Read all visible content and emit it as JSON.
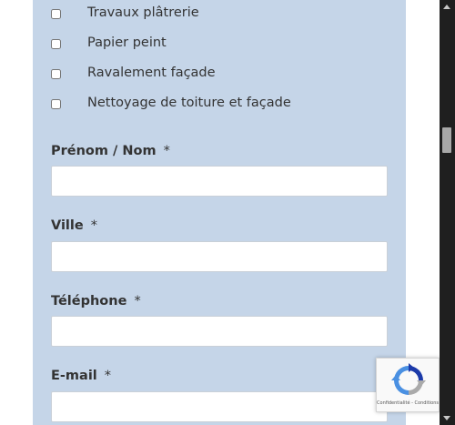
{
  "options": [
    {
      "label": "Travaux plâtrerie",
      "checked": false
    },
    {
      "label": "Papier peint",
      "checked": false
    },
    {
      "label": "Ravalement façade",
      "checked": false
    },
    {
      "label": "Nettoyage de toiture et façade",
      "checked": false
    }
  ],
  "fields": {
    "name": {
      "label": "Prénom / Nom",
      "required": "*",
      "value": ""
    },
    "city": {
      "label": "Ville",
      "required": "*",
      "value": ""
    },
    "phone": {
      "label": "Téléphone",
      "required": "*",
      "value": ""
    },
    "email": {
      "label": "E-mail",
      "required": "*",
      "value": ""
    }
  },
  "recaptcha": {
    "terms": "Confidentialité - Conditions",
    "icon": "recaptcha-icon"
  },
  "colors": {
    "panel": "#c5d5e8",
    "scrollbar": "#1f1f1f",
    "text": "#333333"
  }
}
